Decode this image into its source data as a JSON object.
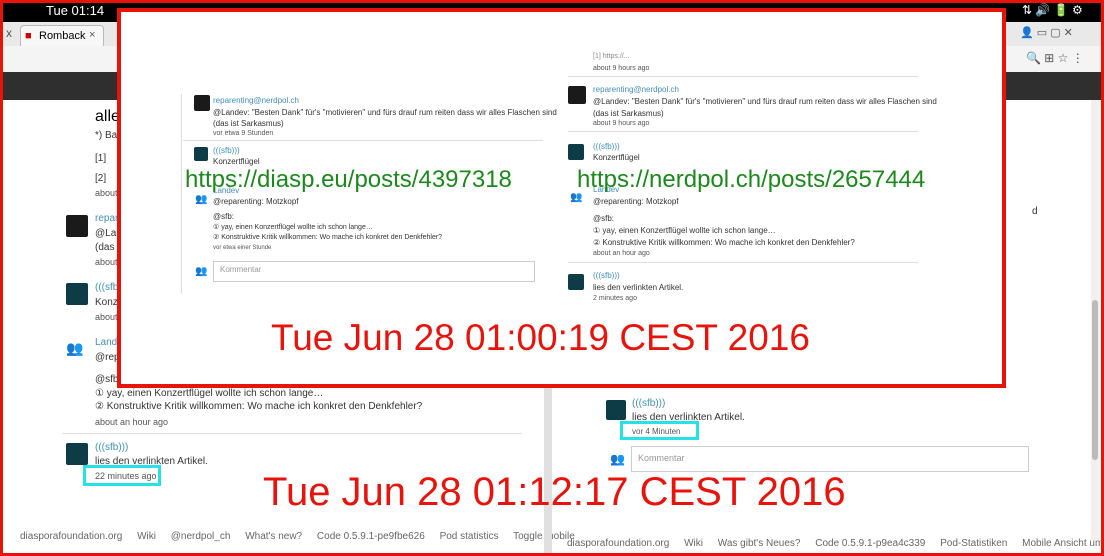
{
  "system": {
    "clock": "Tue 01:14"
  },
  "browser": {
    "tab_label": "Romback"
  },
  "background": {
    "left": {
      "line_truncated": "allen",
      "footnote_star": "*) Ba",
      "ref1": "[1]",
      "ref2": "[2]",
      "about": "about",
      "reparenting": {
        "name": "repar",
        "text1": "@La",
        "text2": "(das",
        "time": "about"
      },
      "sfb1": {
        "name": "(((sfb)",
        "text": "Konz",
        "time": "about"
      },
      "landev": {
        "name": "Land",
        "line1": "@repa",
        "line2": "@sfb:",
        "line3": "① yay, einen Konzertflügel wollte ich schon lange…",
        "line4": "② Konstruktive Kritik willkommen: Wo mache ich konkret den Denkfehler?",
        "time": "about an hour ago"
      },
      "sfb2": {
        "name": "(((sfb)))",
        "text": "lies den verlinkten Artikel.",
        "time": "22 minutes ago"
      },
      "footer": [
        "diasporafoundation.org",
        "Wiki",
        "@nerdpol_ch",
        "What's new?",
        "Code 0.5.9.1-pe9fbe626",
        "Pod statistics",
        "Toggle mobile"
      ]
    },
    "right": {
      "trailing": "d",
      "sfb": {
        "name": "(((sfb)))",
        "text": "lies den verlinkten Artikel.",
        "time": "vor 4 Minuten"
      },
      "comment_placeholder": "Kommentar",
      "footer": [
        "diasporafoundation.org",
        "Wiki",
        "Was gibt's Neues?",
        "Code 0.5.9.1-p9ea4c339",
        "Pod-Statistiken",
        "Mobile Ansicht umschalten"
      ]
    }
  },
  "timestamps": {
    "outer": "Tue Jun 28 01:12:17 CEST 2016",
    "inner": "Tue Jun 28 01:00:19 CEST 2016"
  },
  "inner": {
    "url_left": "https://diasp.eu/posts/4397318",
    "url_right": "https://nerdpol.ch/posts/2657444",
    "left": {
      "reparenting": {
        "name": "reparenting@nerdpol.ch",
        "text1": "@Landev: \"Besten Dank\" für's \"motivieren\" und fürs drauf rum reiten dass wir alles Flaschen sind",
        "text2": "(das ist Sarkasmus)",
        "time": "vor etwa 9 Stunden"
      },
      "sfb": {
        "name": "(((sfb)))",
        "text": "Konzertflügel"
      },
      "landev": {
        "name": "Landev",
        "line1": "@reparenting: Motzkopf",
        "line2": "@sfb:",
        "line3": "① yay, einen Konzertflügel wollte ich schon lange…",
        "line4": "② Konstruktive Kritik willkommen: Wo mache ich konkret den Denkfehler?",
        "time": "vor etwa einer Stunde"
      },
      "comment_placeholder": "Kommentar"
    },
    "right": {
      "top_fragment": "[1] https://...",
      "top_time": "about 9 hours ago",
      "reparenting": {
        "name": "reparenting@nerdpol.ch",
        "text1": "@Landev: \"Besten Dank\" für's \"motivieren\" und fürs drauf rum reiten dass wir alles Flaschen sind",
        "text2": "(das ist Sarkasmus)",
        "time": "about 9 hours ago"
      },
      "sfb1": {
        "name": "(((sfb)))",
        "text": "Konzertflügel"
      },
      "landev": {
        "name": "Landev",
        "line1": "@reparenting: Motzkopf",
        "line2": "@sfb:",
        "line3": "① yay, einen Konzertflügel wollte ich schon lange…",
        "line4": "② Konstruktive Kritik willkommen: Wo mache ich konkret den Denkfehler?",
        "time": "about an hour ago"
      },
      "sfb2": {
        "name": "(((sfb)))",
        "text": "lies den verlinkten Artikel.",
        "time": "2 minutes ago"
      }
    }
  },
  "colors": {
    "red": "#e8140c",
    "cyan": "#25e2e6",
    "green": "#1b8a1b",
    "link": "#3f8fba"
  }
}
